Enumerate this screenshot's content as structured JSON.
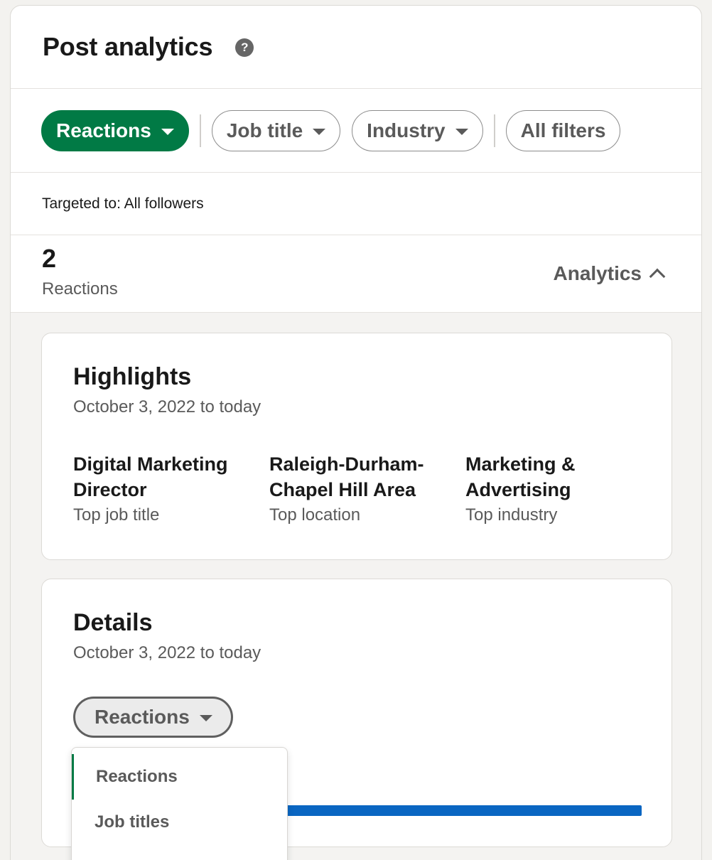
{
  "header": {
    "title": "Post analytics",
    "help_icon": "question-circle-icon"
  },
  "filters": {
    "reactions": "Reactions",
    "job_title": "Job title",
    "industry": "Industry",
    "all_filters": "All filters",
    "active_color": "#017a45"
  },
  "targeting": {
    "text": "Targeted to: All followers"
  },
  "summary": {
    "count": "2",
    "label": "Reactions",
    "analytics_toggle": "Analytics"
  },
  "highlights": {
    "title": "Highlights",
    "date_range": "October 3, 2022 to today",
    "items": [
      {
        "value": "Digital Marketing Director",
        "label": "Top job title"
      },
      {
        "value": "Raleigh-Durham-Chapel Hill Area",
        "label": "Top location"
      },
      {
        "value": "Marketing & Advertising",
        "label": "Top industry"
      }
    ]
  },
  "details": {
    "title": "Details",
    "date_range": "October 3, 2022 to today",
    "selector_label": "Reactions",
    "bar_color": "#0a66c2"
  },
  "dropdown": {
    "options": [
      "Reactions",
      "Job titles"
    ],
    "selected": "Reactions"
  }
}
